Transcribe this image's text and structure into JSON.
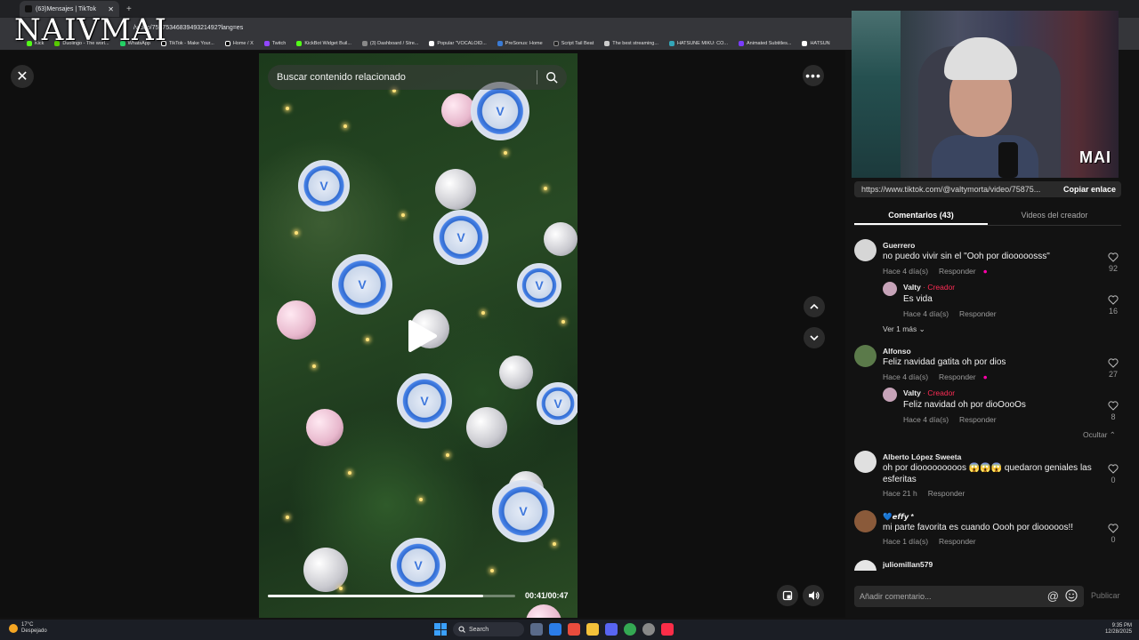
{
  "browser": {
    "tab_title": "(63)Mensajes | TikTok",
    "url": "/video/7587534683949321492?lang=es",
    "bookmarks": [
      "Kick",
      "Duolingo - The worl...",
      "WhatsApp",
      "TikTok - Make Your...",
      "Home / X",
      "Twitch",
      "KickBot Widget Buil...",
      "(3) Dashboard / Stre...",
      "Popular \"VOCALOID...",
      "PreSonus: Home",
      "Script Tail Beat",
      "The best streaming...",
      "HATSUNE MIKU: CO...",
      "Animated Subtitles...",
      "HATSUN"
    ]
  },
  "overlay": {
    "watermark": "NAIVMAI",
    "cam_logo": "MAI"
  },
  "video": {
    "search_placeholder": "Buscar contenido relacionado",
    "time": "00:41/00:47",
    "progress": 0.87
  },
  "panel": {
    "share_url": "https://www.tiktok.com/@valtymorta/video/75875...",
    "copy_label": "Copiar enlace",
    "tabs": [
      "Comentarios (43)",
      "Videos del creador"
    ],
    "comments": [
      {
        "user": "Guerrero",
        "text": "no puedo vivir sin el \"Ooh por diooooosss\"",
        "meta": "Hace 4 día(s)",
        "reply": "Responder",
        "likes": "92"
      },
      {
        "user": "Valty",
        "badge": "· Creador",
        "text": "Es vida",
        "meta": "Hace 4 día(s)",
        "reply": "Responder",
        "likes": "16"
      },
      {
        "view_more": "Ver 1 más"
      },
      {
        "user": "Alfonso",
        "text": "Feliz navidad gatita oh por dios",
        "meta": "Hace 4 día(s)",
        "reply": "Responder",
        "likes": "27"
      },
      {
        "user": "Valty",
        "badge": "· Creador",
        "text": "Feliz navidad oh por dioOooOs",
        "meta": "Hace 4 día(s)",
        "reply": "Responder",
        "likes": "8"
      },
      {
        "hide": "Ocultar"
      },
      {
        "user": "Alberto López Sweeta",
        "text": "oh por diooooooooos 😱😱😱 quedaron geniales las esferitas",
        "meta": "Hace 21 h",
        "reply": "Responder",
        "likes": "0"
      },
      {
        "user": "💙𝙚𝙛𝙛𝙮 *",
        "text": "mi parte favorita es cuando Oooh por diooooos!!",
        "meta": "Hace 1 día(s)",
        "reply": "Responder",
        "likes": "0"
      },
      {
        "user": "juliomillan579"
      }
    ],
    "comment_placeholder": "Añadir comentario...",
    "publish": "Publicar"
  },
  "taskbar": {
    "temp": "17°C",
    "weather": "Despejado",
    "search": "Search",
    "time": "9:35 PM",
    "date": "12/28/2025"
  },
  "colors": {
    "accent": "#fe2c55",
    "bg": "#121212"
  }
}
